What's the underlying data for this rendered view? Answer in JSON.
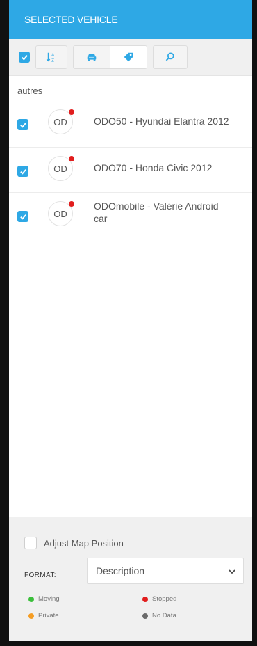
{
  "header": {
    "title": "SELECTED VEHICLE"
  },
  "section": {
    "title": "autres"
  },
  "vehicles": [
    {
      "initials": "OD",
      "label": "ODO50 - Hyundai Elantra 2012",
      "status_color": "#e11d1d"
    },
    {
      "initials": "OD",
      "label": "ODO70 - Honda Civic 2012",
      "status_color": "#e11d1d"
    },
    {
      "initials": "OD",
      "label_line1": "ODOmobile - Valérie Android",
      "label_line2": "car",
      "status_color": "#e11d1d"
    }
  ],
  "footer": {
    "adjust_label": "Adjust Map Position",
    "format_label": "FORMAT:",
    "format_value": "Description"
  },
  "legend": [
    {
      "label": "Moving",
      "color": "#3bbf3b"
    },
    {
      "label": "Stopped",
      "color": "#e11d1d"
    },
    {
      "label": "Private",
      "color": "#f59d23"
    },
    {
      "label": "No Data",
      "color": "#6b6b6b"
    }
  ],
  "colors": {
    "accent": "#2ea8e5",
    "panel_bg": "#f0f0f0"
  },
  "icons": {
    "sort": "sort-alpha-icon",
    "car": "car-icon",
    "tag": "tag-icon",
    "search": "search-icon"
  }
}
